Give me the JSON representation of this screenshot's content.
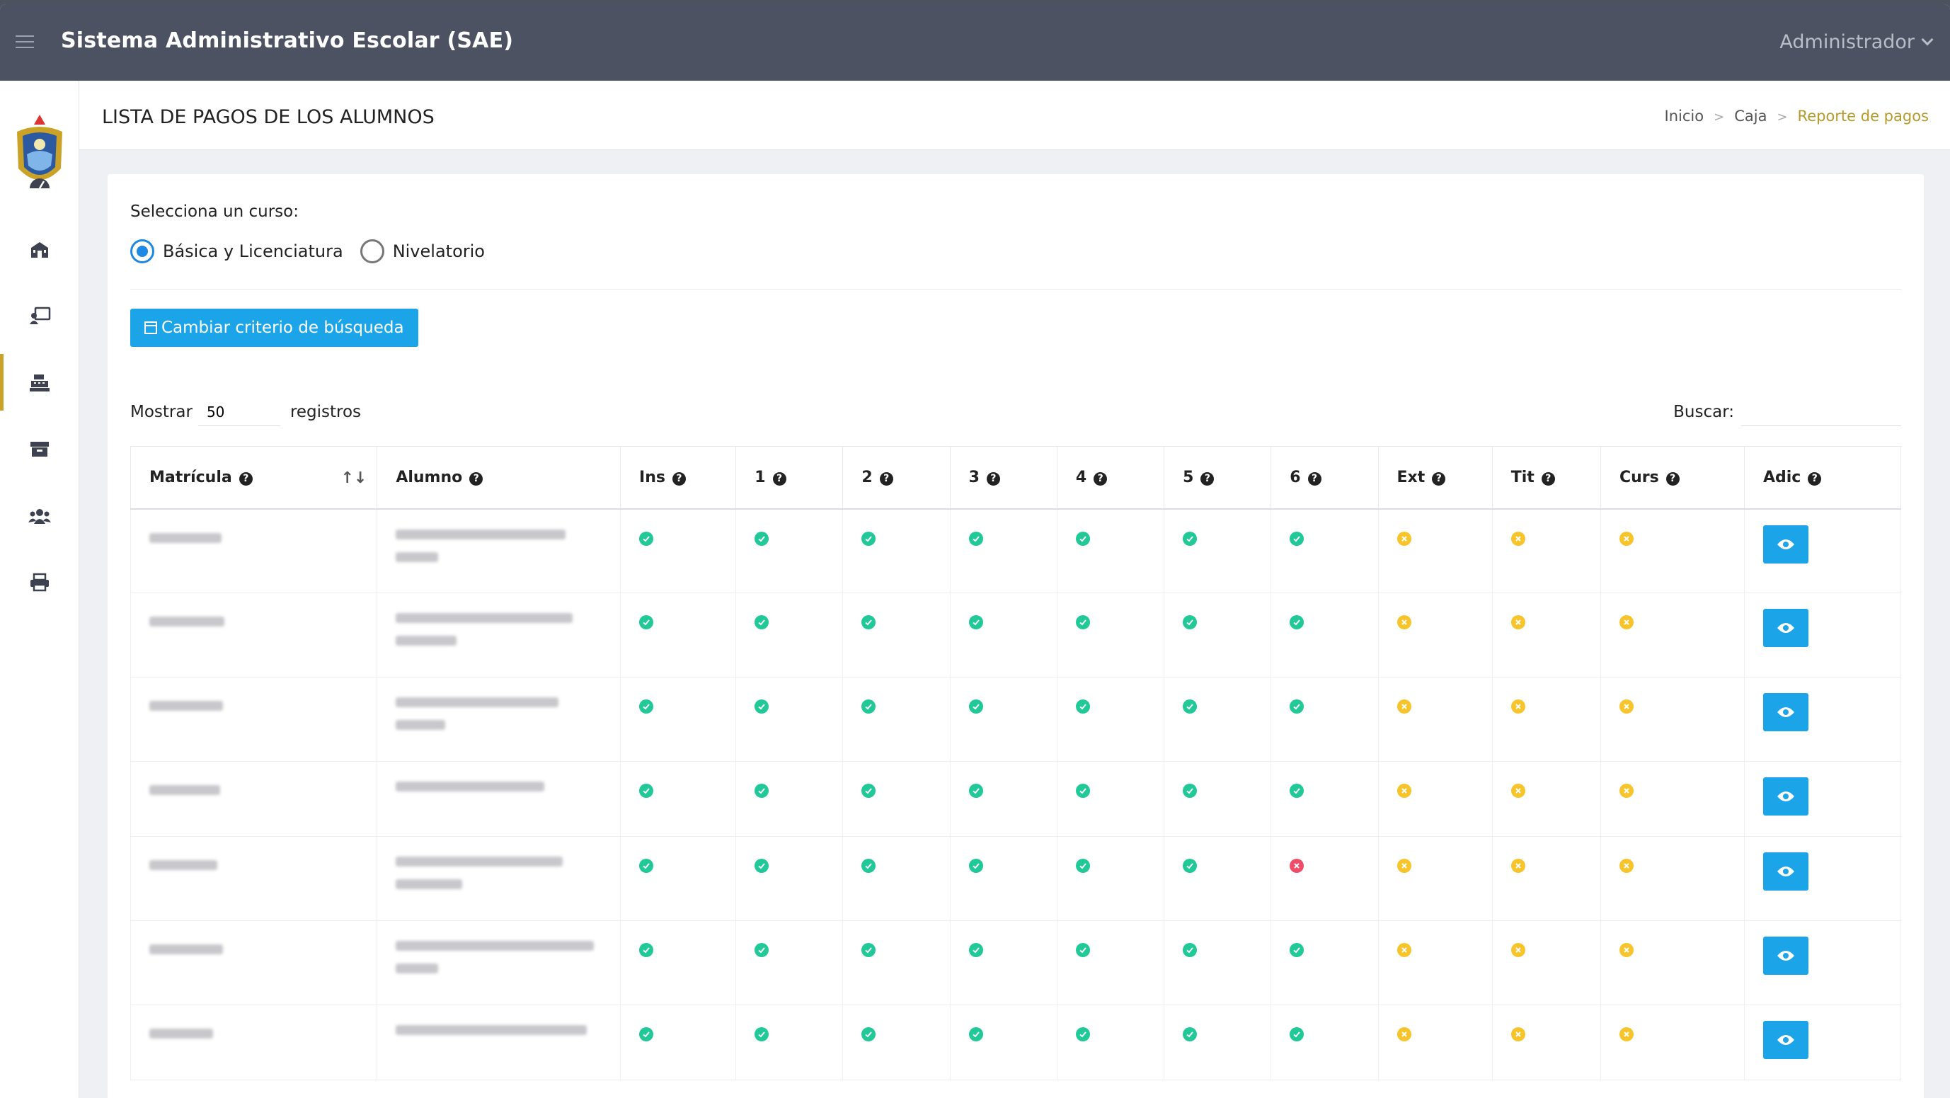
{
  "app": {
    "title": "Sistema Administrativo Escolar (SAE)",
    "user": "Administrador"
  },
  "page": {
    "title": "LISTA DE PAGOS DE LOS ALUMNOS"
  },
  "breadcrumb": [
    "Inicio",
    "Caja",
    "Reporte de pagos"
  ],
  "sidebar": {
    "icons": [
      "dashboard-icon",
      "school-icon",
      "teacher-icon",
      "cash-register-icon",
      "archive-icon",
      "users-icon",
      "print-icon"
    ],
    "active_index": 3
  },
  "filters": {
    "course_label": "Selecciona un curso:",
    "options": [
      "Básica y Licenciatura",
      "Nivelatorio"
    ],
    "selected_index": 0,
    "change_button": "Cambiar criterio de búsqueda"
  },
  "table_controls": {
    "show_label": "Mostrar",
    "show_value": "50",
    "records_label": "registros",
    "search_label": "Buscar:"
  },
  "table": {
    "columns": [
      "Matrícula",
      "Alumno",
      "Ins",
      "1",
      "2",
      "3",
      "4",
      "5",
      "6",
      "Ext",
      "Tit",
      "Curs",
      "Adic"
    ],
    "rows": [
      {
        "status": [
          "ok",
          "ok",
          "ok",
          "ok",
          "ok",
          "ok",
          "ok",
          "pend",
          "pend",
          "pend"
        ]
      },
      {
        "status": [
          "ok",
          "ok",
          "ok",
          "ok",
          "ok",
          "ok",
          "ok",
          "pend",
          "pend",
          "pend"
        ]
      },
      {
        "status": [
          "ok",
          "ok",
          "ok",
          "ok",
          "ok",
          "ok",
          "ok",
          "pend",
          "pend",
          "pend"
        ]
      },
      {
        "status": [
          "ok",
          "ok",
          "ok",
          "ok",
          "ok",
          "ok",
          "ok",
          "pend",
          "pend",
          "pend"
        ]
      },
      {
        "status": [
          "ok",
          "ok",
          "ok",
          "ok",
          "ok",
          "ok",
          "bad",
          "pend",
          "pend",
          "pend"
        ]
      },
      {
        "status": [
          "ok",
          "ok",
          "ok",
          "ok",
          "ok",
          "ok",
          "ok",
          "pend",
          "pend",
          "pend"
        ]
      },
      {
        "status": [
          "ok",
          "ok",
          "ok",
          "ok",
          "ok",
          "ok",
          "ok",
          "pend",
          "pend",
          "pend"
        ]
      }
    ]
  },
  "colors": {
    "topbar": "#4d5263",
    "accent": "#1ba4e8",
    "paid": "#20c997",
    "pending": "#f7c52b",
    "unpaid": "#ef4d6a",
    "active": "#c9a227"
  }
}
